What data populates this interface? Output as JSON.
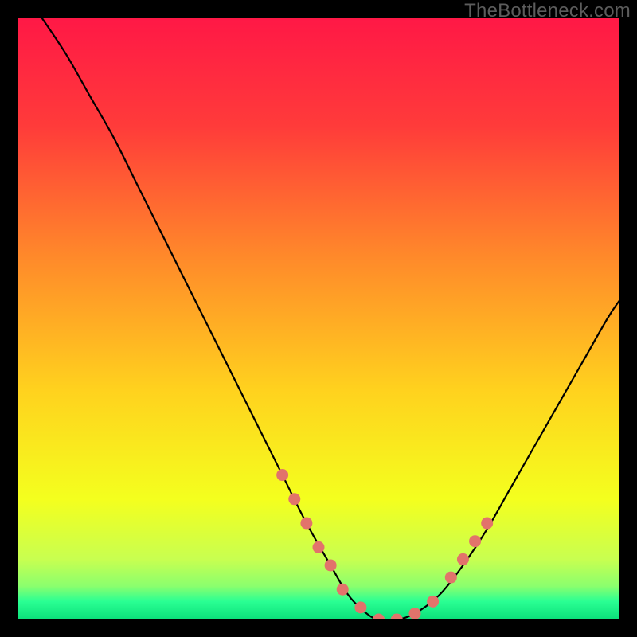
{
  "watermark": "TheBottleneck.com",
  "chart_data": {
    "type": "line",
    "title": "",
    "xlabel": "",
    "ylabel": "",
    "xlim": [
      0,
      100
    ],
    "ylim": [
      0,
      100
    ],
    "grid": false,
    "legend": false,
    "series": [
      {
        "name": "bottleneck-curve",
        "x": [
          4,
          8,
          12,
          16,
          20,
          24,
          28,
          32,
          36,
          40,
          44,
          48,
          52,
          55,
          58,
          60,
          63,
          66,
          70,
          74,
          78,
          82,
          86,
          90,
          94,
          98,
          100
        ],
        "y": [
          100,
          94,
          87,
          80,
          72,
          64,
          56,
          48,
          40,
          32,
          24,
          16,
          9,
          4,
          1,
          0,
          0,
          1,
          4,
          9,
          15,
          22,
          29,
          36,
          43,
          50,
          53
        ]
      }
    ],
    "markers": {
      "name": "highlight-dots",
      "x": [
        44,
        46,
        48,
        50,
        52,
        54,
        57,
        60,
        63,
        66,
        69,
        72,
        74,
        76,
        78
      ],
      "y": [
        24,
        20,
        16,
        12,
        9,
        5,
        2,
        0,
        0,
        1,
        3,
        7,
        10,
        13,
        16
      ]
    },
    "background_gradient": {
      "stops": [
        {
          "offset": 0.0,
          "color": "#ff1846"
        },
        {
          "offset": 0.18,
          "color": "#ff3b3a"
        },
        {
          "offset": 0.4,
          "color": "#ff8a2a"
        },
        {
          "offset": 0.62,
          "color": "#ffd21e"
        },
        {
          "offset": 0.8,
          "color": "#f4ff1e"
        },
        {
          "offset": 0.9,
          "color": "#c8ff50"
        },
        {
          "offset": 0.945,
          "color": "#8aff6e"
        },
        {
          "offset": 0.97,
          "color": "#2aff93"
        },
        {
          "offset": 1.0,
          "color": "#0be07a"
        }
      ]
    }
  }
}
